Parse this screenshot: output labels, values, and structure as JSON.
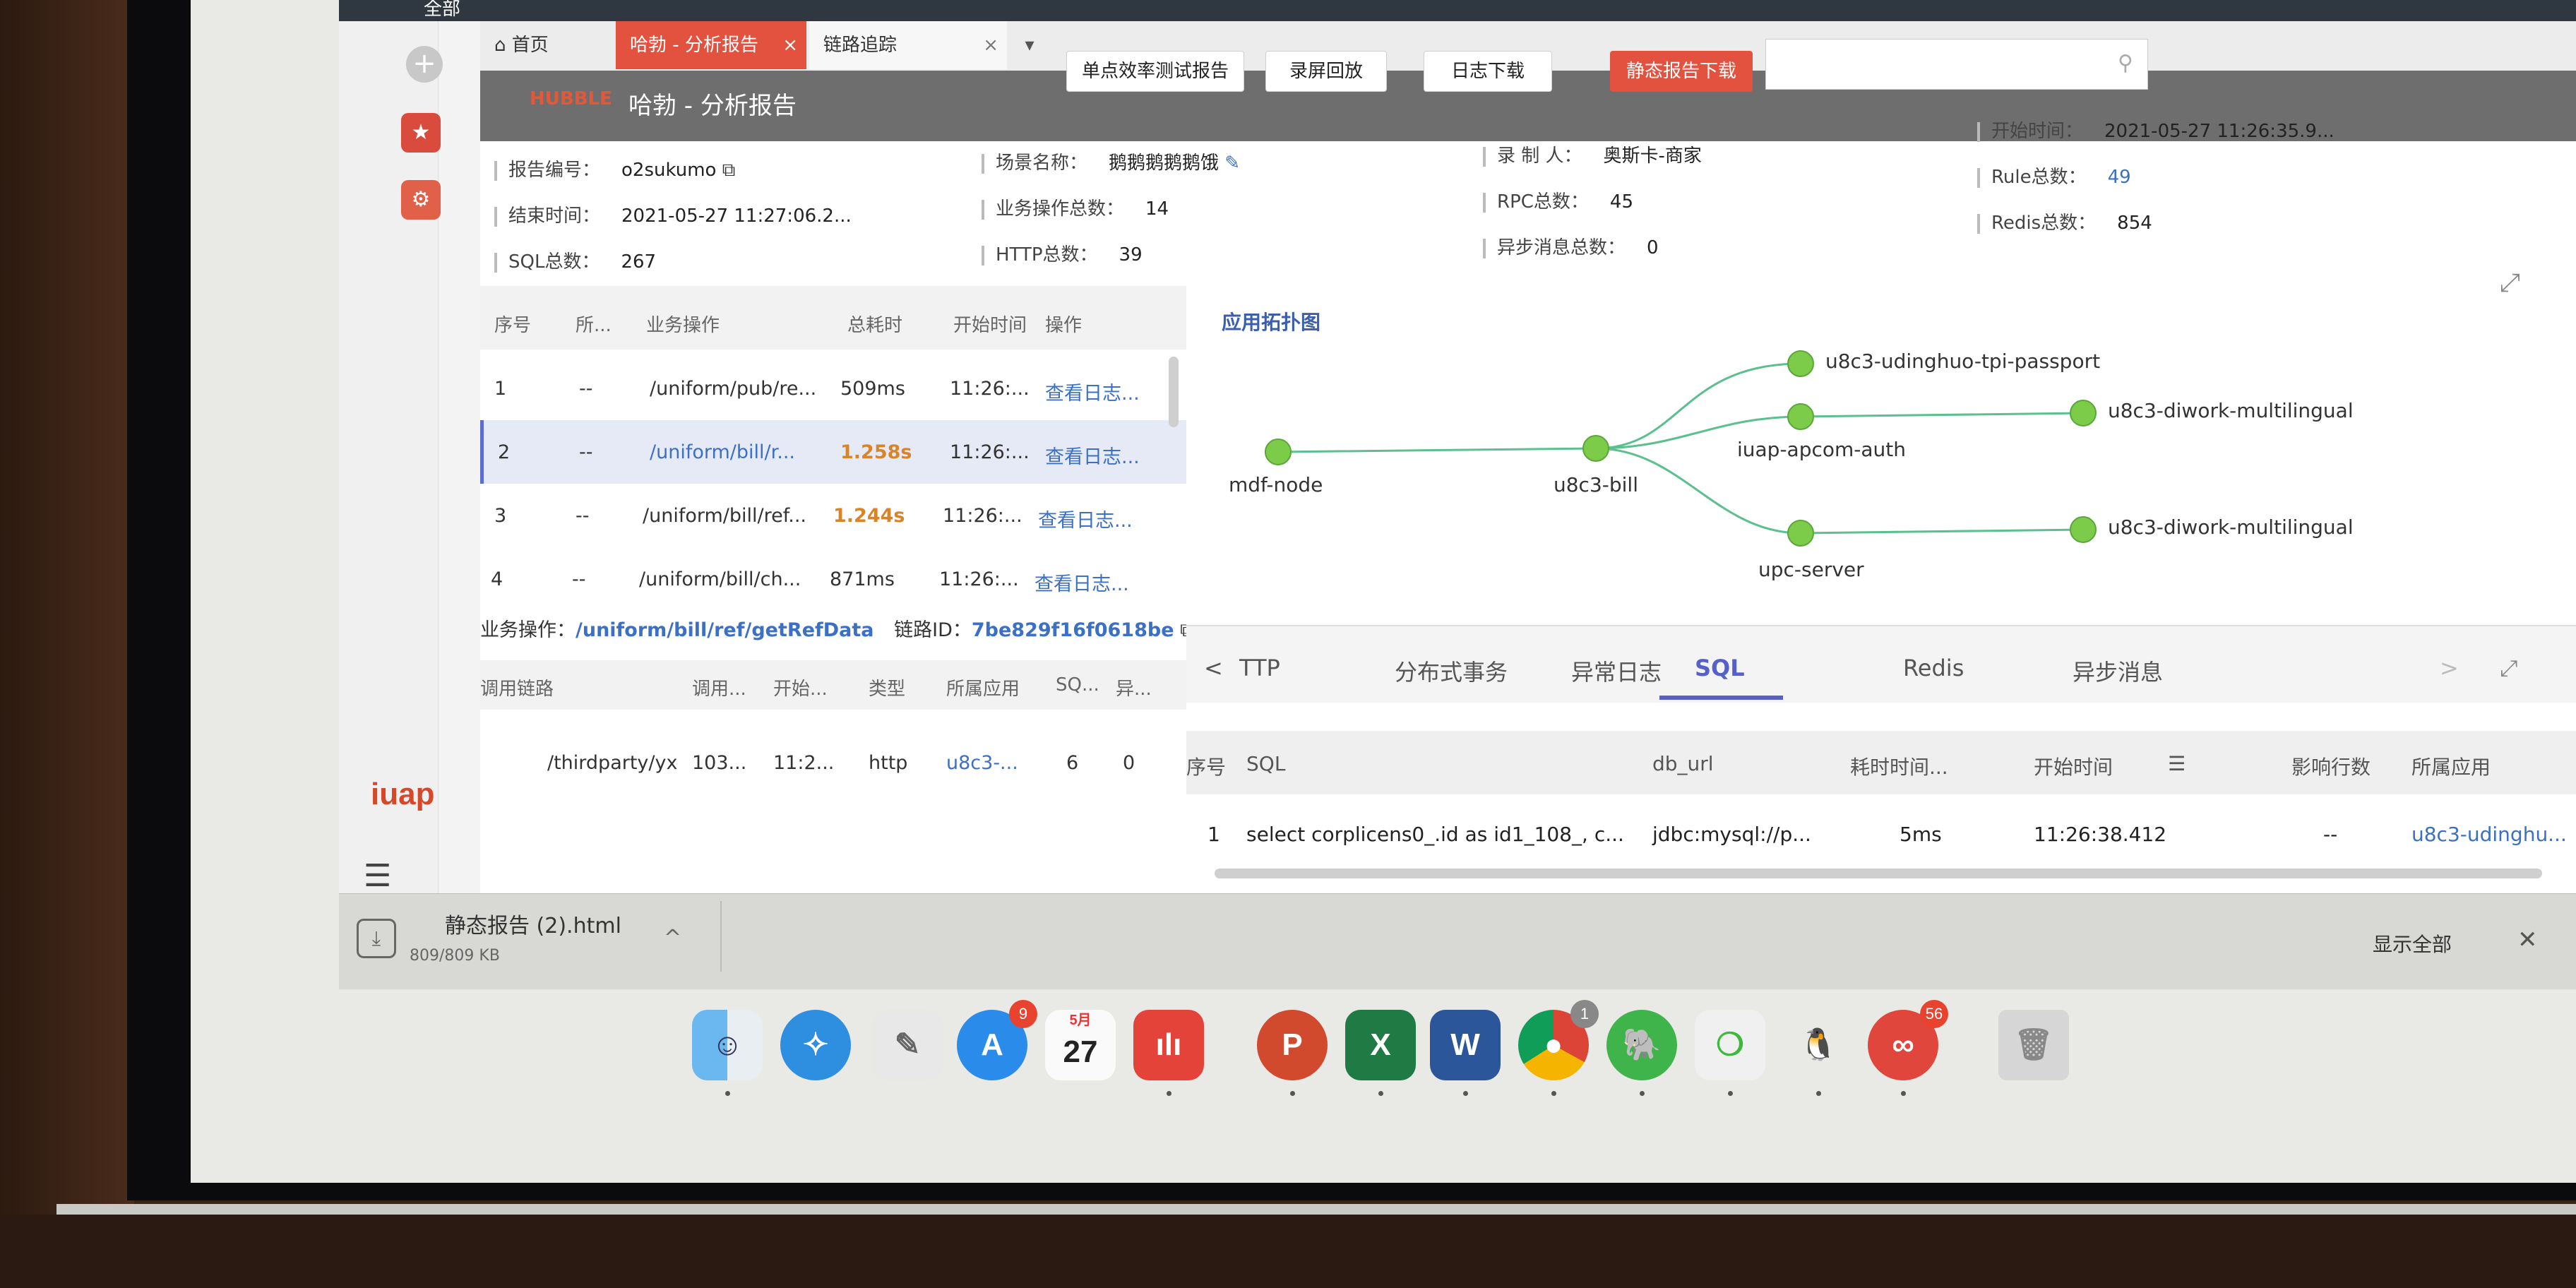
{
  "browser": {
    "top_label": "全部",
    "tabs": {
      "home": "首页",
      "report": "哈勃 - 分析报告",
      "trace": "链路追踪",
      "close": "×",
      "dropdown": "▾"
    }
  },
  "sidebar": {
    "add": "+",
    "star": "★",
    "app": "⚙",
    "logo": "iuap",
    "menu": "☰"
  },
  "header": {
    "logo": "HUBBLE",
    "title": "哈勃 - 分析报告",
    "buttons": {
      "perf_test": "单点效率测试报告",
      "replay": "录屏回放",
      "log_download": "日志下载",
      "static_report": "静态报告下载"
    },
    "search_icon": "⚲"
  },
  "info": {
    "report_no_label": "报告编号：",
    "report_no": "o2sukumo",
    "scene_label": "场景名称：",
    "scene": "鹅鹅鹅鹅鹅饿",
    "recorder_label": "录 制 人：",
    "recorder": "奥斯卡-商家",
    "start_label": "开始时间：",
    "start": "2021-05-27 11:26:35.9...",
    "end_label": "结束时间：",
    "end": "2021-05-27 11:27:06.2...",
    "ops_label": "业务操作总数：",
    "ops": "14",
    "rpc_label": "RPC总数：",
    "rpc": "45",
    "rule_label": "Rule总数：",
    "rule": "49",
    "sql_label": "SQL总数：",
    "sql": "267",
    "http_label": "HTTP总数：",
    "http": "39",
    "async_label": "异步消息总数：",
    "async": "0",
    "redis_label": "Redis总数：",
    "redis": "854"
  },
  "ops_table": {
    "headers": [
      "序号",
      "所...",
      "业务操作",
      "总耗时",
      "开始时间",
      "操作"
    ],
    "rows": [
      {
        "no": "1",
        "owner": "--",
        "op": "/uniform/pub/re...",
        "time": "509ms",
        "start": "11:26:...",
        "action": "查看日志..."
      },
      {
        "no": "2",
        "owner": "--",
        "op": "/uniform/bill/r...",
        "time": "1.258s",
        "start": "11:26:...",
        "action": "查看日志..."
      },
      {
        "no": "3",
        "owner": "--",
        "op": "/uniform/bill/ref...",
        "time": "1.244s",
        "start": "11:26:...",
        "action": "查看日志..."
      },
      {
        "no": "4",
        "owner": "--",
        "op": "/uniform/bill/ch...",
        "time": "871ms",
        "start": "11:26:...",
        "action": "查看日志..."
      }
    ],
    "bizop_label": "业务操作：",
    "bizop_value": "/uniform/bill/ref/getRefData",
    "chain_label": "链路ID：",
    "chain_value": "7be829f16f0618be"
  },
  "call_table": {
    "headers": [
      "调用链路",
      "调用...",
      "开始...",
      "类型",
      "所属应用",
      "SQ...",
      "异..."
    ],
    "row": {
      "path": "/thirdparty/yx",
      "call": "103...",
      "start": "11:2...",
      "type": "http",
      "app": "u8c3-...",
      "sql": "6",
      "async": "0"
    }
  },
  "topology": {
    "title": "应用拓扑图",
    "expand": "⤢",
    "nodes": {
      "mdf": "mdf-node",
      "bill": "u8c3-bill",
      "passport": "u8c3-udinghuo-tpi-passport",
      "auth": "iuap-apcom-auth",
      "upc": "upc-server",
      "diwork1": "u8c3-diwork-multilingual",
      "diwork2": "u8c3-diwork-multilingual"
    }
  },
  "detail_tabs": {
    "prev": "<",
    "http": "TTP",
    "dist": "分布式事务",
    "err": "异常日志",
    "sql": "SQL",
    "redis": "Redis",
    "async": "异步消息",
    "next": ">"
  },
  "sql_table": {
    "headers": {
      "no": "序号",
      "sql": "SQL",
      "db": "db_url",
      "time": "耗时时间...",
      "start": "开始时间",
      "rows": "影响行数",
      "app": "所属应用"
    },
    "row": {
      "no": "1",
      "sql": "select corplicens0_.id as id1_108_, c...",
      "db": "jdbc:mysql://p...",
      "time": "5ms",
      "start": "11:26:38.412",
      "rows": "--",
      "app": "u8c3-udinghu..."
    }
  },
  "download": {
    "filename": "静态报告 (2).html",
    "size": "809/809 KB",
    "chevron": "^",
    "show_all": "显示全部",
    "close": "✕"
  },
  "dock": {
    "calendar_month": "5月",
    "calendar_day": "27",
    "appstore_badge": "9",
    "chrome_badge": "1",
    "app_badge": "56",
    "powerpoint": "P",
    "excel": "X",
    "word": "W"
  }
}
